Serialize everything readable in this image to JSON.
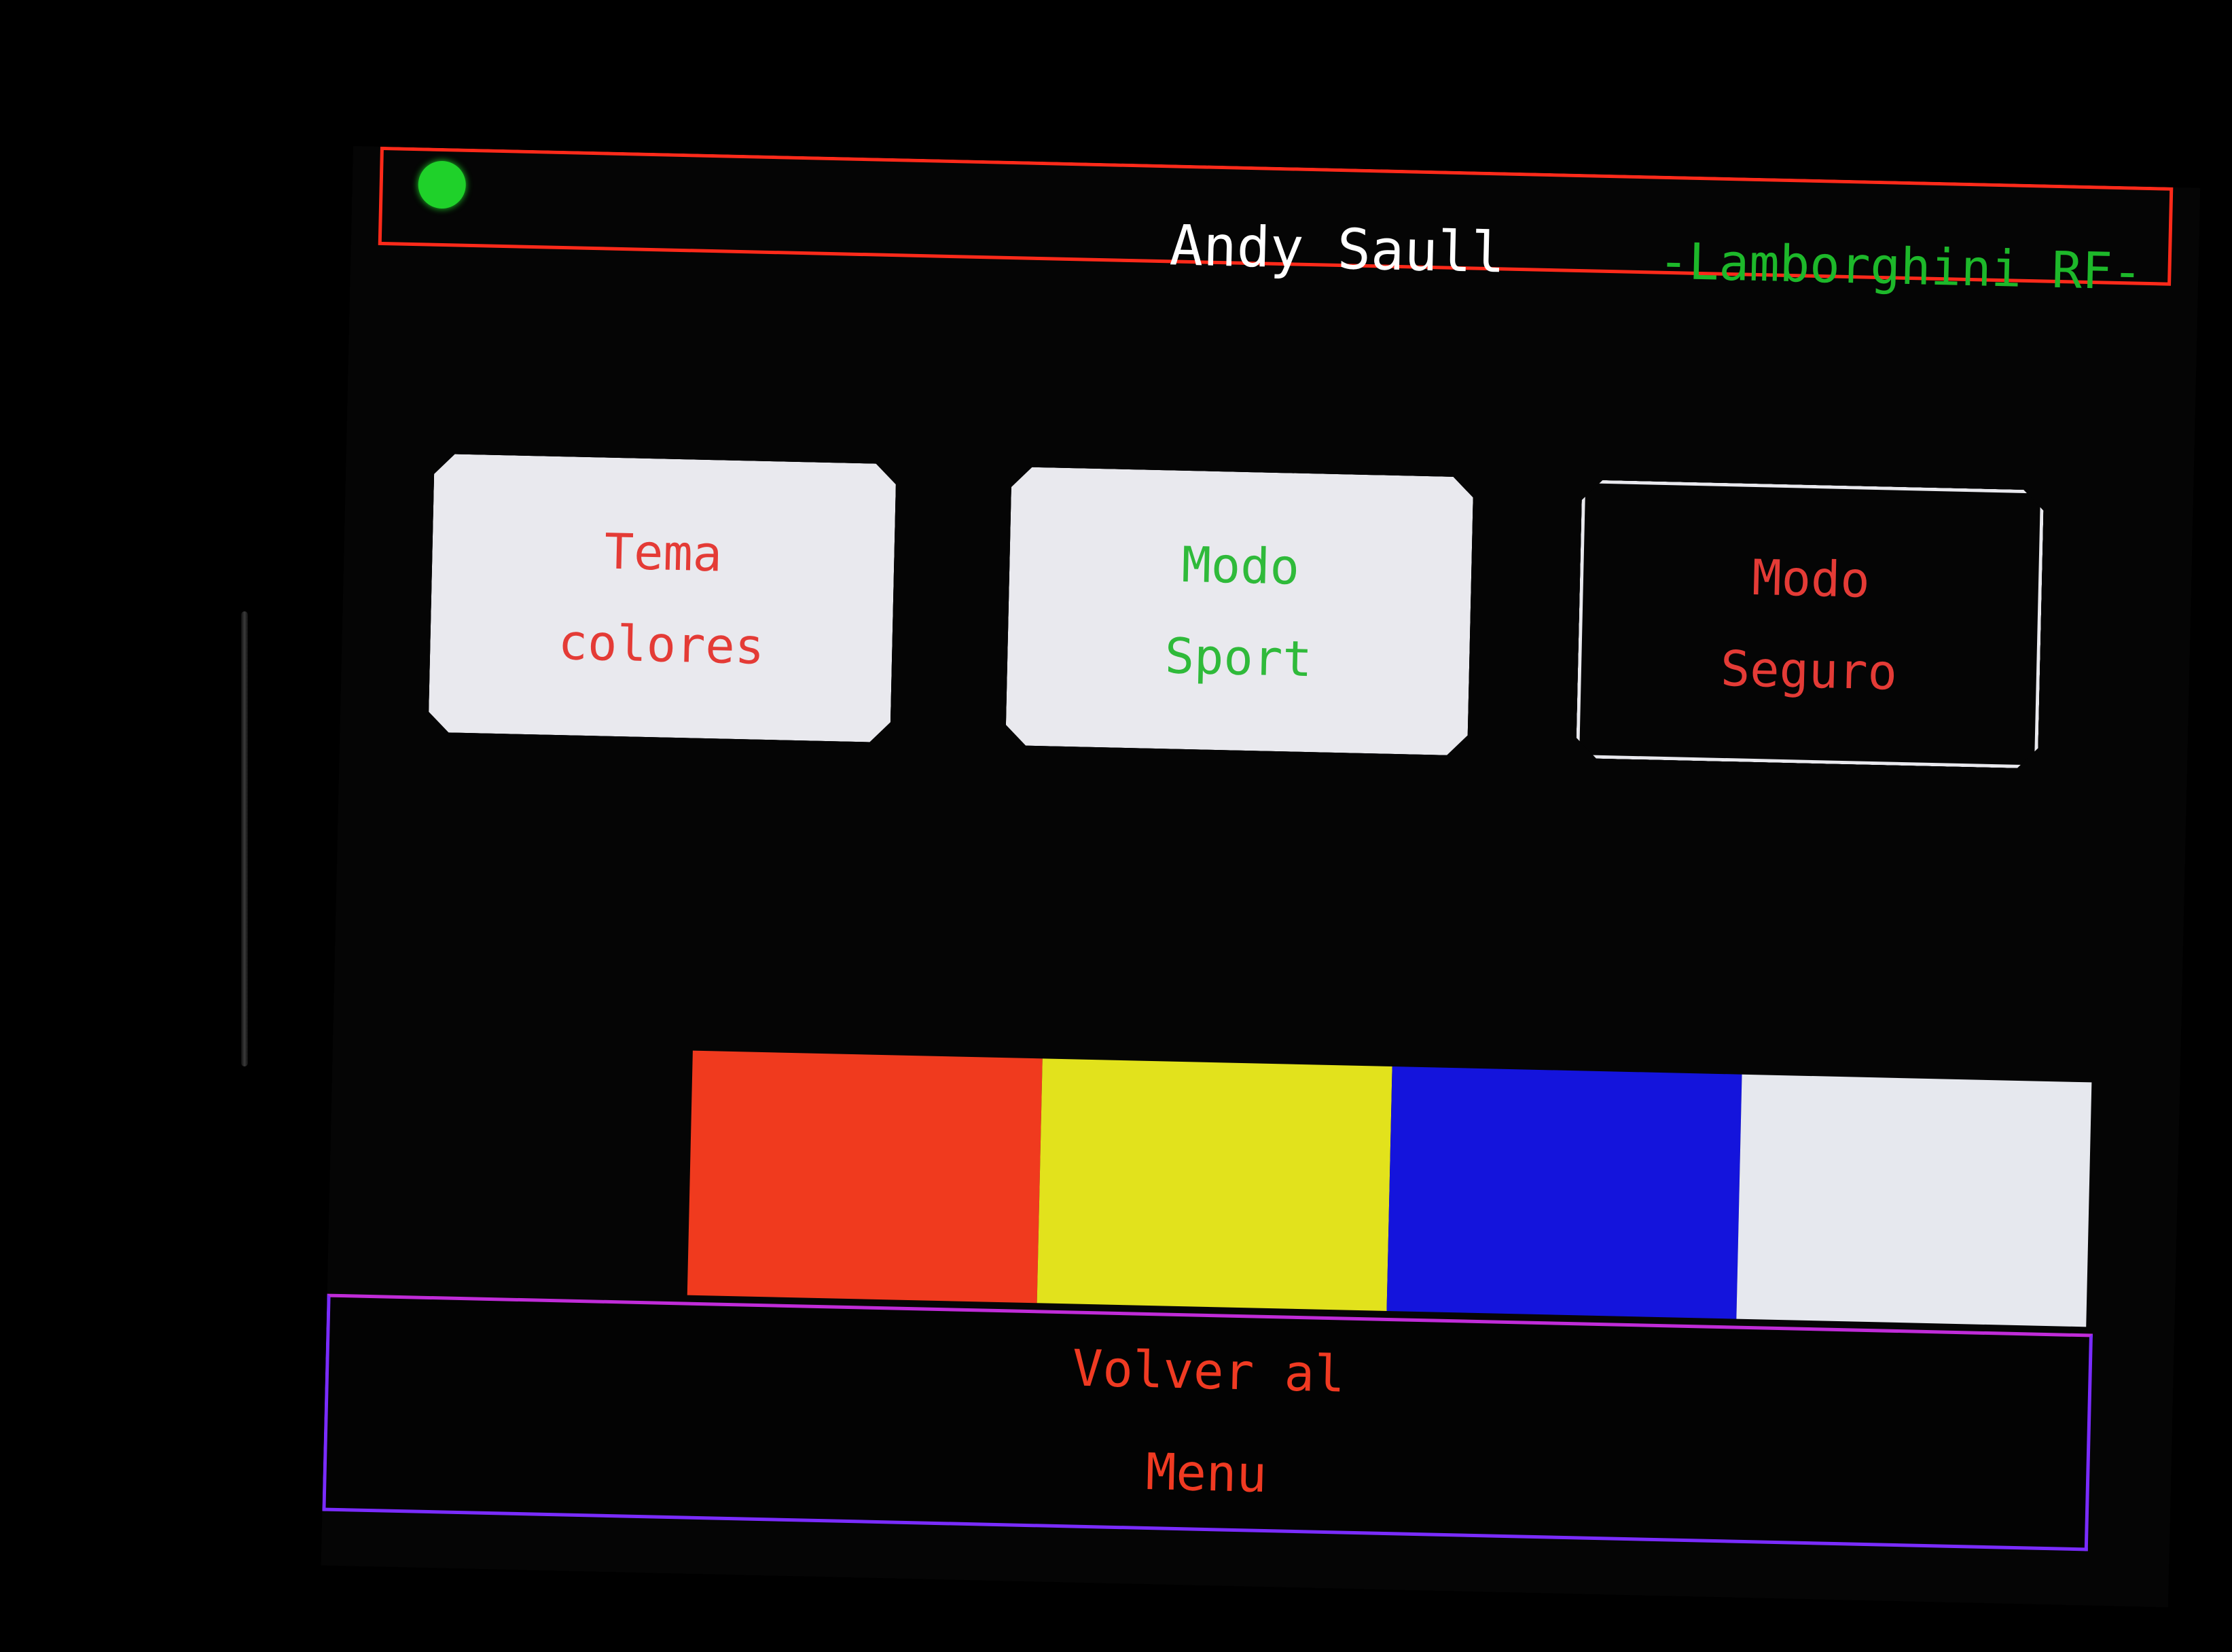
{
  "header": {
    "user_name": "Andy Saull",
    "brand": "-Lamborghini RF-",
    "status_led_color": "#1fd12a"
  },
  "modes": [
    {
      "line1": "Tema",
      "line2": "colores",
      "style": "filled",
      "text_color": "#e43b36"
    },
    {
      "line1": "Modo",
      "line2": "Sport",
      "style": "filled",
      "text_color": "#2fba3a"
    },
    {
      "line1": "Modo",
      "line2": "Seguro",
      "style": "outline",
      "text_color": "#e43b36"
    }
  ],
  "palette": {
    "swatches": [
      {
        "name": "red-swatch",
        "color": "#f03a1e"
      },
      {
        "name": "yellow-swatch",
        "color": "#e2e21c"
      },
      {
        "name": "blue-swatch",
        "color": "#1414dc"
      },
      {
        "name": "white-swatch",
        "color": "#e6e8ee"
      }
    ]
  },
  "footer": {
    "back_line1": "Volver al",
    "back_line2": "Menu"
  },
  "colors": {
    "title_border": "#ff2a1a",
    "footer_border": "#7a2cff",
    "card_fill": "#e9e9ee"
  }
}
